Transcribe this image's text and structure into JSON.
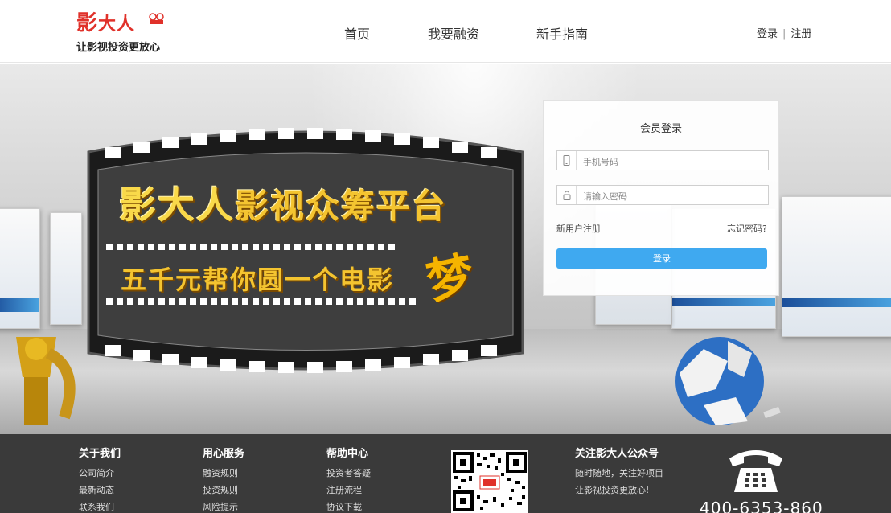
{
  "brand": {
    "logo_text_1": "影",
    "logo_text_2": "大人",
    "slogan": "让影视投资更放心"
  },
  "nav": {
    "items": [
      "首页",
      "我要融资",
      "新手指南"
    ]
  },
  "auth": {
    "login": "登录",
    "separator": "|",
    "register": "注册"
  },
  "hero": {
    "title_part1": "影大人",
    "title_part2": "影视众筹平台",
    "subtitle": "五千元帮你圆一个电影",
    "dream_char": "梦"
  },
  "login_box": {
    "title": "会员登录",
    "phone_placeholder": "手机号码",
    "password_placeholder": "请输入密码",
    "new_user_link": "新用户注册",
    "forgot_link": "忘记密码?",
    "submit": "登录"
  },
  "footer": {
    "columns": [
      {
        "heading": "关于我们",
        "items": [
          "公司简介",
          "最新动态",
          "联系我们"
        ]
      },
      {
        "heading": "用心服务",
        "items": [
          "融资规则",
          "投资规则",
          "风险提示"
        ]
      },
      {
        "heading": "帮助中心",
        "items": [
          "投资者答疑",
          "注册流程",
          "协议下载"
        ]
      }
    ],
    "follow": {
      "heading": "关注影大人公众号",
      "line1": "随时随地，关注好项目",
      "line2": "让影视投资更放心!"
    },
    "phone": "400-6353-860"
  },
  "colors": {
    "brand_red": "#e0312a",
    "login_button": "#3fa9f0",
    "footer_bg": "#3a3a3a",
    "hero_gold": "#f4c430"
  }
}
